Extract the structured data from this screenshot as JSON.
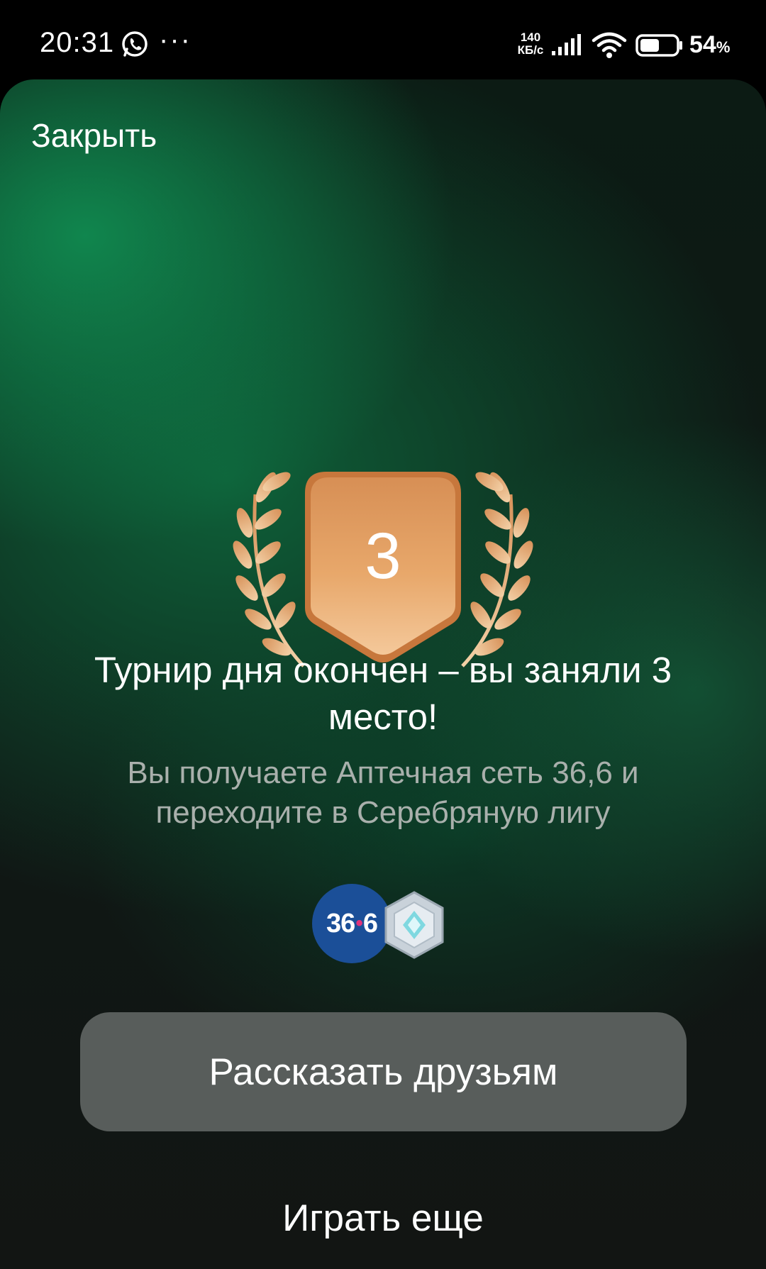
{
  "status_bar": {
    "time": "20:31",
    "notification_icons": [
      "whatsapp-icon"
    ],
    "more_indicator": "···",
    "net_speed_value": "140",
    "net_speed_unit": "КБ/с",
    "battery_percent": "54",
    "battery_symbol": "%",
    "battery_level": 0.54
  },
  "header": {
    "close_label": "Закрыть"
  },
  "result": {
    "place": "3",
    "title": "Турнир дня окончен – вы заняли 3 место!",
    "subtitle": "Вы получаете Аптечная сеть 36,6 и переходите в Серебряную лигу"
  },
  "rewards": {
    "partner_logo_left": "36",
    "partner_logo_dot": "•",
    "partner_logo_right": "6",
    "league_badge_icon": "silver-league-badge-icon"
  },
  "actions": {
    "share_label": "Рассказать друзьям",
    "play_again_label": "Играть еще"
  },
  "colors": {
    "accent_green": "#0f8a50",
    "medal_bronze": "#e9a86e",
    "partner_blue": "#1b4f98",
    "button_gray": "#585d5b"
  }
}
